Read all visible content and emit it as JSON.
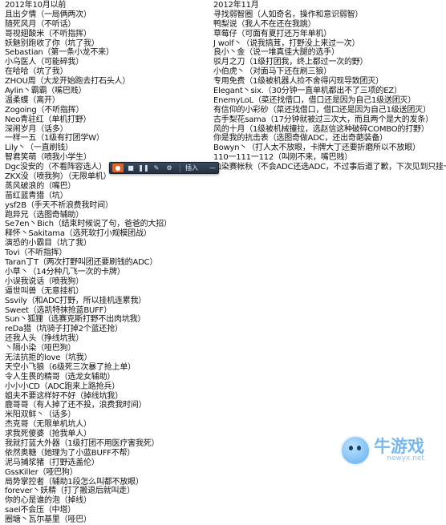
{
  "left_column": {
    "heading": "2012年10月以前",
    "lines": [
      "且出夕情（一局俩两次）",
      "随死风月（不听话）",
      "哥视翅酸米（不听指挥）",
      "妖魅别跑收了你（坑了我）",
      "Sebastian（第一条小龙不来）",
      "小乌医人（可能碎我）",
      "在哈哈（坑了我）",
      "ZHOU周（大龙开始跑去打石头人）",
      "Aylin丶霸霸（嘴巴贱）",
      "温柔蝶（离开）",
      "Zogoing（不听指挥）",
      "Neo青驻红（单机打野）",
      "深闹岁月（话多）",
      "一样一五（1级有打团学W）",
      "Lily丶（一直刷钱）",
      "智君笑萌（喷我小学生）",
      "Dgc没安的（不看阵容选人）",
      "ZKX没（喷我狗）（无限单机）",
      "蒸风破浪的（嘴巴）",
      "苗红蓝青猎（坑）",
      "ysf2B（手天不祈浪费我时间）",
      "跑异兄（选图奇辅助）",
      "Se7en丶Bich（结束时候说了句，爸爸的大招）",
      "释怀丶Sakitama（选死软打小规模团战）",
      "演恐的小霸目（坑了我）",
      "Tovi（不听指挥）",
      "Taran丁T（两次打野叫团还要刷钱的ADC）",
      "小草丶（14分种几飞一次的卡牌）",
      "小误我说话（喷我狗）",
      "逼世叫兽（无意挂机）",
      "Ssvily（和ADC打野，所以挂机连累我）",
      "Sweet（选凯特抹抢蓝BUFF）",
      "Sun丶狐狸（选赛克斯打野不出肉坑我）",
      "reDa猎（坑骑子打掉2个蓝还抢）",
      "还我人头（挣线坑我）",
      "丶隔小染（哑巴狗）",
      "无法抗拒的love（坑我）",
      "天空小飞狼（6级死三次暴了抢上单）",
      "令人生畏的精哥（选龙女辅助）",
      "小小小CD（ADC跑来上路抢兵）",
      "姐夫不要这样好不好（掉线坑我）",
      "鹿哥哥（有人掉了还不投，浪费我时间）",
      "米阳双鲜丶（话多）",
      "杰克哥（无限单机坑人）",
      "求我死傻婆（抢我单人）",
      "我就打蓝大外器（1级打团不用医疗害我死）",
      "依然奥糖（她理为了小蓝BUFF不帮）",
      "泥马捕浆猪（打野选盖伦）",
      "GssKiller（哑巴狗）",
      "局势掌控者（辅助1段怎么叫都不放眼）",
      "forever丶妖精（打了搬退后就叫走）",
      "你的心是谁的泡（掉线）",
      "sael不会压（中塔）",
      "圈塘丶瓦尔基里（哑巴）"
    ]
  },
  "right_column": {
    "heading": "2012年11月",
    "lines": [
      "寻找弱智圈（人如奇名，操作和意识弱智）",
      "鸭梨说（我人不在还在我跳）",
      "草莓仔（可面有夏打还万年单机）",
      "J wolf丶（说我搞茸，打野没上来过一次）",
      "良小丶金（说一堆真佳大腿的选手）",
      "驳月之刀（1级打团我，终上都过一次的野）",
      "小伯虎丶（对面马下还在刷三狼）",
      "专用免费（1级被机器人捡不舍得闪现导致团灭）",
      "Elegant丶six.（30分钟一直单机都出不了三项的EZ）",
      "EnemyLoL（菜还找借口，借口还是因为自己1级送团灭）",
      "有信仰的小彩砂（菜还找借口，借口还是因为自己1级送团灭）",
      "古手梨花sama（17分钟就被过三次大，而且两个是大的发条）",
      "风的十月（1级被机械撞拉，选赵信这种破碎COMBO的打野）",
      "你是我的抗击表（选图奇做ADC，还出奇葩装备）",
      "Bowyn丶（打人太不放眼，卡牌大丁还要折磨所以不放眼）",
      "110一111一112（叫刚不来，嘴巴贱）",
      "血染赛帐秋（不会ADC还选ADC，不过事后道了歉，下次见到只挂一次）"
    ]
  },
  "toolbar": {
    "record_icon": "record-icon",
    "stop_icon": "stop-icon",
    "pause_icon": "pause-icon",
    "pen_icon": "pen-icon",
    "settings_icon": "settings-icon",
    "label": "插入",
    "minimize_icon": "minimize-icon"
  },
  "watermark": {
    "name": "牛游戏",
    "url": "newyx.net"
  }
}
